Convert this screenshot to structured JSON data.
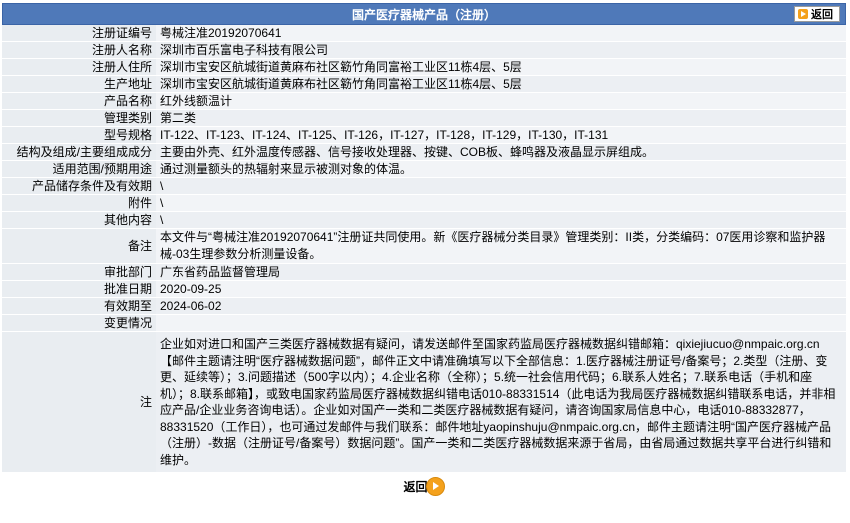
{
  "header": {
    "title": "国产医疗器械产品（注册）",
    "back_label": "返回"
  },
  "rows": [
    {
      "label": "注册证编号",
      "value": "粤械注准20192070641"
    },
    {
      "label": "注册人名称",
      "value": "深圳市百乐富电子科技有限公司"
    },
    {
      "label": "注册人住所",
      "value": "深圳市宝安区航城街道黄麻布社区簕竹角同富裕工业区11栋4层、5层"
    },
    {
      "label": "生产地址",
      "value": "深圳市宝安区航城街道黄麻布社区簕竹角同富裕工业区11栋4层、5层"
    },
    {
      "label": "产品名称",
      "value": "红外线额温计"
    },
    {
      "label": "管理类别",
      "value": "第二类"
    },
    {
      "label": "型号规格",
      "value": "IT-122、IT-123、IT-124、IT-125、IT-126，IT-127，IT-128，IT-129，IT-130，IT-131"
    },
    {
      "label": "结构及组成/主要组成成分",
      "value": "主要由外壳、红外温度传感器、信号接收处理器、按键、COB板、蜂鸣器及液晶显示屏组成。"
    },
    {
      "label": "适用范围/预期用途",
      "value": "通过测量额头的热辐射来显示被测对象的体温。"
    },
    {
      "label": "产品储存条件及有效期",
      "value": "\\"
    },
    {
      "label": "附件",
      "value": "\\"
    },
    {
      "label": "其他内容",
      "value": "\\"
    },
    {
      "label": "备注",
      "value": "本文件与“粤械注准20192070641”注册证共同使用。新《医疗器械分类目录》管理类别：II类，分类编码：07医用诊察和监护器械-03生理参数分析测量设备。"
    },
    {
      "label": "审批部门",
      "value": "广东省药品监督管理局"
    },
    {
      "label": "批准日期",
      "value": "2020-09-25"
    },
    {
      "label": "有效期至",
      "value": "2024-06-02"
    },
    {
      "label": "变更情况",
      "value": ""
    }
  ],
  "note": {
    "label": "注",
    "value": "企业如对进口和国产三类医疗器械数据有疑问，请发送邮件至国家药监局医疗器械数据纠错邮箱：qixiejiucuo@nmpaic.org.cn【邮件主题请注明“医疗器械数据问题”，邮件正文中请准确填写以下全部信息：1.医疗器械注册证号/备案号；2.类型（注册、变更、延续等）；3.问题描述（500字以内）；4.企业名称（全称）；5.统一社会信用代码；6.联系人姓名；7.联系电话（手机和座机）；8.联系邮箱】，或致电国家药监局医疗器械数据纠错电话010-88331514（此电话为我局医疗器械数据纠错联系电话，并非相应产品/企业业务咨询电话）。企业如对国产一类和二类医疗器械数据有疑问，请咨询国家局信息中心，电话010-88332877，88331520（工作日），也可通过发邮件与我们联系：邮件地址yaopinshuju@nmpaic.org.cn，邮件主题请注明“国产医疗器械产品（注册）-数据（注册证号/备案号）数据问题”。国产一类和二类医疗器械数据来源于省局，由省局通过数据共享平台进行纠错和维护。"
  },
  "footer": {
    "back_label": "返回"
  },
  "colors": {
    "title_bar": "#4f79b9",
    "label_bg": "#e9edf1",
    "value_bg": "#f2f4f7",
    "accent": "#f4a11c"
  }
}
